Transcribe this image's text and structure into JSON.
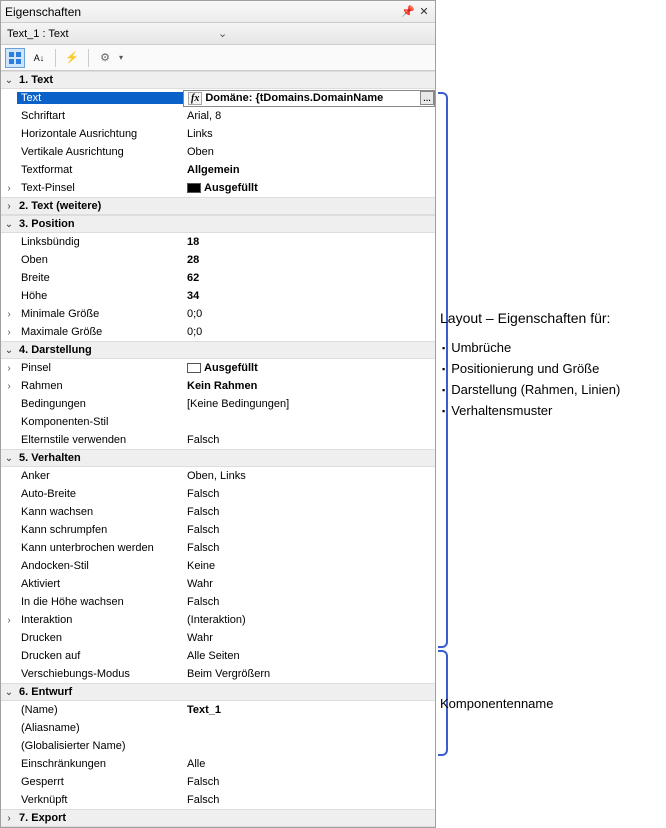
{
  "window": {
    "title": "Eigenschaften"
  },
  "selector": {
    "value": "Text_1 : Text"
  },
  "categories": [
    {
      "label": "1. Text",
      "expanded": true,
      "rows": [
        {
          "name": "Text",
          "value": "Domäne: {tDomains.DomainName",
          "selected": true,
          "fx": true,
          "edit": true,
          "bold": true
        },
        {
          "name": "Schriftart",
          "value": "Arial, 8"
        },
        {
          "name": "Horizontale Ausrichtung",
          "value": "Links"
        },
        {
          "name": "Vertikale Ausrichtung",
          "value": "Oben"
        },
        {
          "name": "Textformat",
          "value": "Allgemein",
          "bold": true
        },
        {
          "name": "Text-Pinsel",
          "value": "Ausgefüllt",
          "expander": true,
          "swatch": "black",
          "bold": true
        }
      ]
    },
    {
      "label": "2. Text (weitere)",
      "expanded": false,
      "rows": []
    },
    {
      "label": "3. Position",
      "expanded": true,
      "rows": [
        {
          "name": "Linksbündig",
          "value": "18",
          "bold": true
        },
        {
          "name": "Oben",
          "value": "28",
          "bold": true
        },
        {
          "name": "Breite",
          "value": "62",
          "bold": true
        },
        {
          "name": "Höhe",
          "value": "34",
          "bold": true
        },
        {
          "name": "Minimale Größe",
          "value": "0;0",
          "expander": true
        },
        {
          "name": "Maximale Größe",
          "value": "0;0",
          "expander": true
        }
      ]
    },
    {
      "label": "4. Darstellung",
      "expanded": true,
      "rows": [
        {
          "name": "Pinsel",
          "value": "Ausgefüllt",
          "expander": true,
          "swatch": "white",
          "bold": true
        },
        {
          "name": "Rahmen",
          "value": "Kein Rahmen",
          "expander": true,
          "bold": true
        },
        {
          "name": "Bedingungen",
          "value": "[Keine Bedingungen]"
        },
        {
          "name": "Komponenten-Stil",
          "value": ""
        },
        {
          "name": "Elternstile verwenden",
          "value": "Falsch"
        }
      ]
    },
    {
      "label": "5. Verhalten",
      "expanded": true,
      "rows": [
        {
          "name": "Anker",
          "value": "Oben, Links"
        },
        {
          "name": "Auto-Breite",
          "value": "Falsch"
        },
        {
          "name": "Kann wachsen",
          "value": "Falsch"
        },
        {
          "name": "Kann schrumpfen",
          "value": "Falsch"
        },
        {
          "name": "Kann unterbrochen werden",
          "value": "Falsch"
        },
        {
          "name": "Andocken-Stil",
          "value": "Keine"
        },
        {
          "name": "Aktiviert",
          "value": "Wahr"
        },
        {
          "name": "In die Höhe wachsen",
          "value": "Falsch"
        },
        {
          "name": "Interaktion",
          "value": "(Interaktion)",
          "expander": true
        },
        {
          "name": "Drucken",
          "value": "Wahr"
        },
        {
          "name": "Drucken auf",
          "value": "Alle Seiten"
        },
        {
          "name": "Verschiebungs-Modus",
          "value": "Beim Vergrößern"
        }
      ]
    },
    {
      "label": "6. Entwurf",
      "expanded": true,
      "rows": [
        {
          "name": "(Name)",
          "value": "Text_1",
          "bold": true
        },
        {
          "name": "(Aliasname)",
          "value": ""
        },
        {
          "name": "(Globalisierter Name)",
          "value": ""
        },
        {
          "name": "Einschränkungen",
          "value": "Alle"
        },
        {
          "name": "Gesperrt",
          "value": "Falsch"
        },
        {
          "name": "Verknüpft",
          "value": "Falsch"
        }
      ]
    },
    {
      "label": "7. Export",
      "expanded": false,
      "rows": []
    }
  ],
  "annotations": {
    "layout": {
      "title": "Layout – Eigenschaften für:",
      "items": [
        "Umbrüche",
        "Positionierung und Größe",
        "Darstellung (Rahmen, Linien)",
        "Verhaltensmuster"
      ]
    },
    "component": {
      "title": "Komponentenname"
    }
  }
}
